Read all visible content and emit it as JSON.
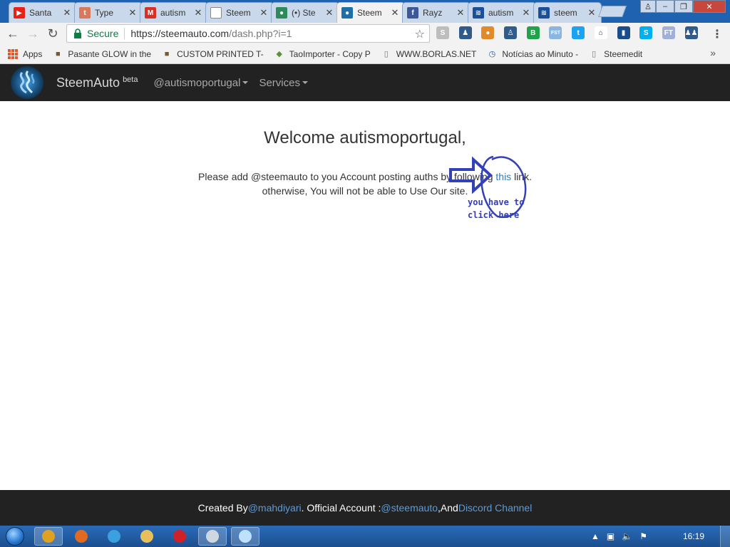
{
  "browser": {
    "tabs": [
      {
        "title": "Santa",
        "favicon": "youtube-icon",
        "color": "#e62117",
        "glyph": "▶"
      },
      {
        "title": "Type",
        "favicon": "tumblr-icon",
        "color": "#d9785a",
        "glyph": "t"
      },
      {
        "title": "autism",
        "favicon": "gmail-icon",
        "color": "#d93025",
        "glyph": "M"
      },
      {
        "title": "Steem",
        "favicon": "page-icon",
        "color": "#ffffff",
        "glyph": ""
      },
      {
        "title": "(•) Ste",
        "favicon": "steem-icon",
        "color": "#2d8a5a",
        "glyph": "●"
      },
      {
        "title": "Steem",
        "favicon": "steemauto-icon",
        "color": "#1d6fa8",
        "glyph": "●",
        "active": true
      },
      {
        "title": "Rayz",
        "favicon": "facebook-icon",
        "color": "#3b5998",
        "glyph": "f"
      },
      {
        "title": "autism",
        "favicon": "steemit-icon",
        "color": "#1a5099",
        "glyph": "≋"
      },
      {
        "title": "steem",
        "favicon": "steemit-icon",
        "color": "#1a5099",
        "glyph": "≋"
      }
    ],
    "address": {
      "secure_label": "Secure",
      "url_main": "https://steemauto.com",
      "url_path": "/dash.php?i=1"
    },
    "bookmarks": [
      {
        "label": "Apps",
        "icon": "apps-grid-icon"
      },
      {
        "label": "Pasante GLOW in the",
        "icon": "bag-icon"
      },
      {
        "label": "CUSTOM PRINTED T-",
        "icon": "bag-icon"
      },
      {
        "label": "TaoImporter - Copy P",
        "icon": "shopify-icon"
      },
      {
        "label": "WWW.BORLAS.NET",
        "icon": "page-icon"
      },
      {
        "label": "Notícias ao Minuto -",
        "icon": "clock-icon"
      },
      {
        "label": "Steemedit",
        "icon": "page-icon"
      }
    ],
    "extensions": [
      {
        "name": "skype-icon",
        "color": "#bdbdbd",
        "glyph": "S"
      },
      {
        "name": "contacts-icon",
        "color": "#2e5a8c",
        "glyph": "♟"
      },
      {
        "name": "cookie-icon",
        "color": "#e08a2a",
        "glyph": "●"
      },
      {
        "name": "person-badge-icon",
        "color": "#2e5a8c",
        "glyph": "♙"
      },
      {
        "name": "b-icon",
        "color": "#1fa34a",
        "glyph": "B"
      },
      {
        "name": "fst-icon",
        "color": "#8bb6e0",
        "glyph": "FST"
      },
      {
        "name": "twitter-icon",
        "color": "#1da1f2",
        "glyph": "t"
      },
      {
        "name": "home-icon",
        "color": "#ffffff",
        "glyph": "⌂"
      },
      {
        "name": "bookmark-icon",
        "color": "#1a4c8a",
        "glyph": "▮"
      },
      {
        "name": "skype-blue-icon",
        "color": "#00aff0",
        "glyph": "S"
      },
      {
        "name": "ft-icon",
        "color": "#a0b0d8",
        "glyph": "FT"
      },
      {
        "name": "group-icon",
        "color": "#2e5a8c",
        "glyph": "♟♟"
      }
    ]
  },
  "site": {
    "brand": "SteemAuto",
    "brand_sup": "beta",
    "user_menu": "@autismoportugal",
    "services_menu": "Services"
  },
  "main": {
    "welcome": "Welcome autismoportugal,",
    "line1_before": "Please add @steemauto to you Account posting auths by following ",
    "line1_link": "this",
    "line1_after": " link.",
    "line2": "otherwise, You will not be able to Use Our site.",
    "annotation_line1": "you have to",
    "annotation_line2": "click here"
  },
  "footer": {
    "created_by": "Created By ",
    "author_link": "@mahdiyari",
    "official": ". Official Account : ",
    "official_link": "@steemauto",
    "and": ",And ",
    "discord_link": "Discord Channel"
  },
  "taskbar": {
    "apps": [
      {
        "name": "chrome-taskbar-icon",
        "color": "#e0a020",
        "active": true
      },
      {
        "name": "firefox-taskbar-icon",
        "color": "#e06a20"
      },
      {
        "name": "ie-taskbar-icon",
        "color": "#3aa0e0"
      },
      {
        "name": "explorer-taskbar-icon",
        "color": "#e8c05a"
      },
      {
        "name": "opera-taskbar-icon",
        "color": "#d0202a"
      },
      {
        "name": "steam-taskbar-icon",
        "color": "#cfd8e0",
        "active": true
      },
      {
        "name": "notepad-taskbar-icon",
        "color": "#bfe0ff",
        "active": true
      }
    ],
    "clock": "16:19"
  },
  "colors": {
    "navbar_bg": "#222222",
    "link": "#337ab7",
    "footer_link": "#5a9bd8",
    "annotation": "#3340b8"
  }
}
